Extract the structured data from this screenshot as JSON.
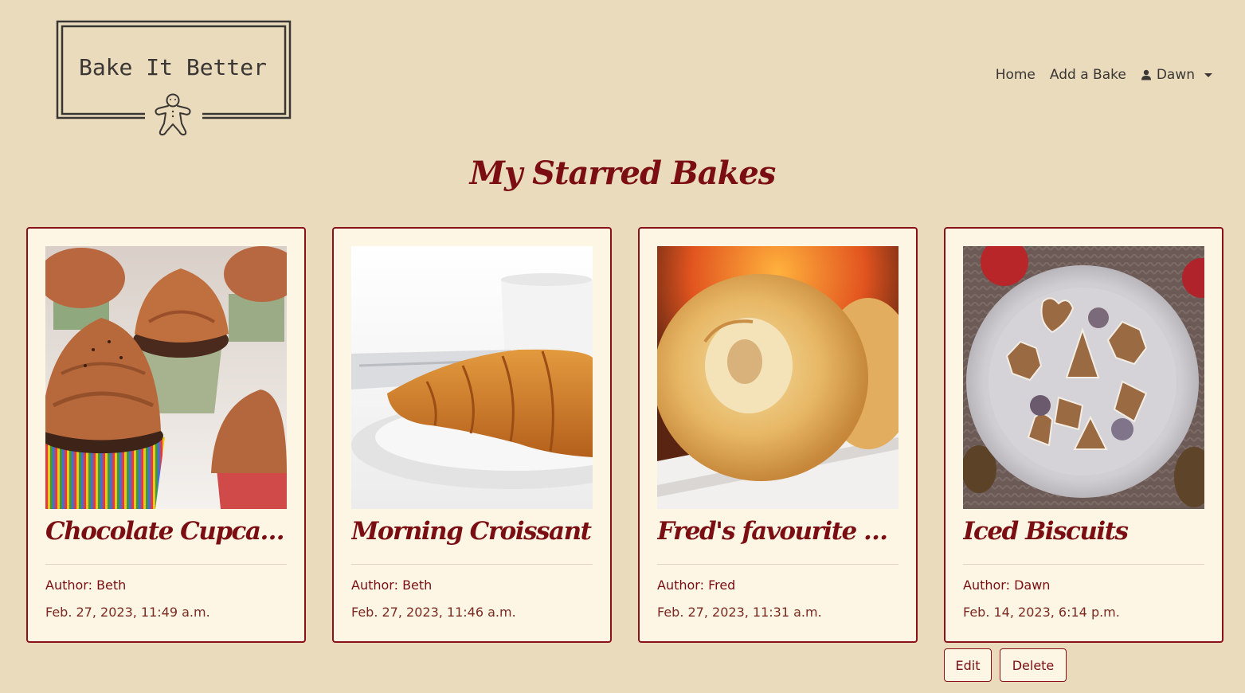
{
  "brand": {
    "name": "Bake It Better",
    "icon": "gingerbread-man-icon"
  },
  "nav": {
    "home": "Home",
    "add_bake": "Add a Bake",
    "user": "Dawn",
    "user_icon": "person-icon"
  },
  "page": {
    "title": "My Starred Bakes"
  },
  "colors": {
    "background": "#e9dbbc",
    "card_background": "#fdf6e4",
    "accent": "#7a0e12"
  },
  "bakes": [
    {
      "title": "Chocolate Cupcakes",
      "author": "Author: Beth",
      "date": "Feb. 27, 2023, 11:49 a.m.",
      "image": "chocolate-cupcakes-photo"
    },
    {
      "title": "Morning Croissant",
      "author": "Author: Beth",
      "date": "Feb. 27, 2023, 11:46 a.m.",
      "image": "croissant-photo"
    },
    {
      "title": "Fred's favourite Yor...",
      "author": "Author: Fred",
      "date": "Feb. 27, 2023, 11:31 a.m.",
      "image": "yorkshire-pudding-photo"
    },
    {
      "title": "Iced Biscuits",
      "author": "Author: Dawn",
      "date": "Feb. 14, 2023, 6:14 p.m.",
      "image": "iced-biscuits-photo"
    }
  ],
  "actions": {
    "edit": "Edit",
    "delete": "Delete"
  }
}
